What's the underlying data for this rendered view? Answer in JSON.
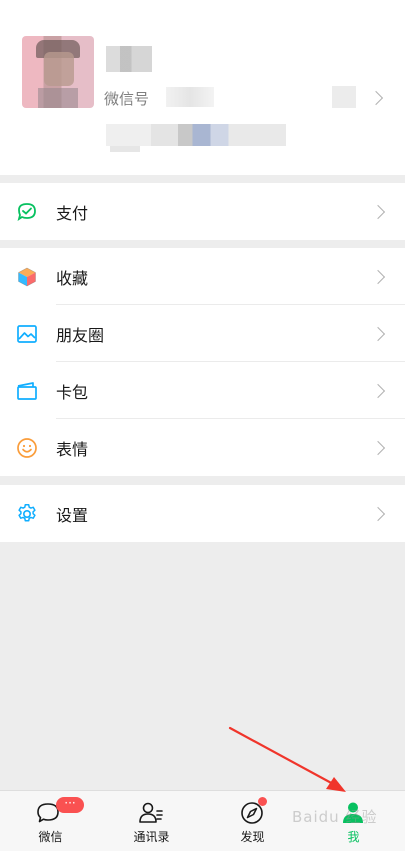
{
  "profile": {
    "wechat_id_label": "微信号"
  },
  "menu_groups": [
    [
      {
        "label": "支付",
        "icon": "pay-icon"
      }
    ],
    [
      {
        "label": "收藏",
        "icon": "favorites-icon"
      },
      {
        "label": "朋友圈",
        "icon": "moments-icon"
      },
      {
        "label": "卡包",
        "icon": "card-wallet-icon"
      },
      {
        "label": "表情",
        "icon": "sticker-icon"
      }
    ],
    [
      {
        "label": "设置",
        "icon": "settings-icon"
      }
    ]
  ],
  "tabbar": {
    "tabs": [
      {
        "label": "微信",
        "icon": "chats-icon",
        "badge": "···"
      },
      {
        "label": "通讯录",
        "icon": "contacts-icon"
      },
      {
        "label": "发现",
        "icon": "discover-icon"
      },
      {
        "label": "我",
        "icon": "me-icon"
      }
    ]
  },
  "colors": {
    "accent_green": "#07c160",
    "badge_red": "#fa5151",
    "background": "#ededed",
    "annotation_arrow": "#f0352b"
  },
  "watermark": "Baidu 经验"
}
